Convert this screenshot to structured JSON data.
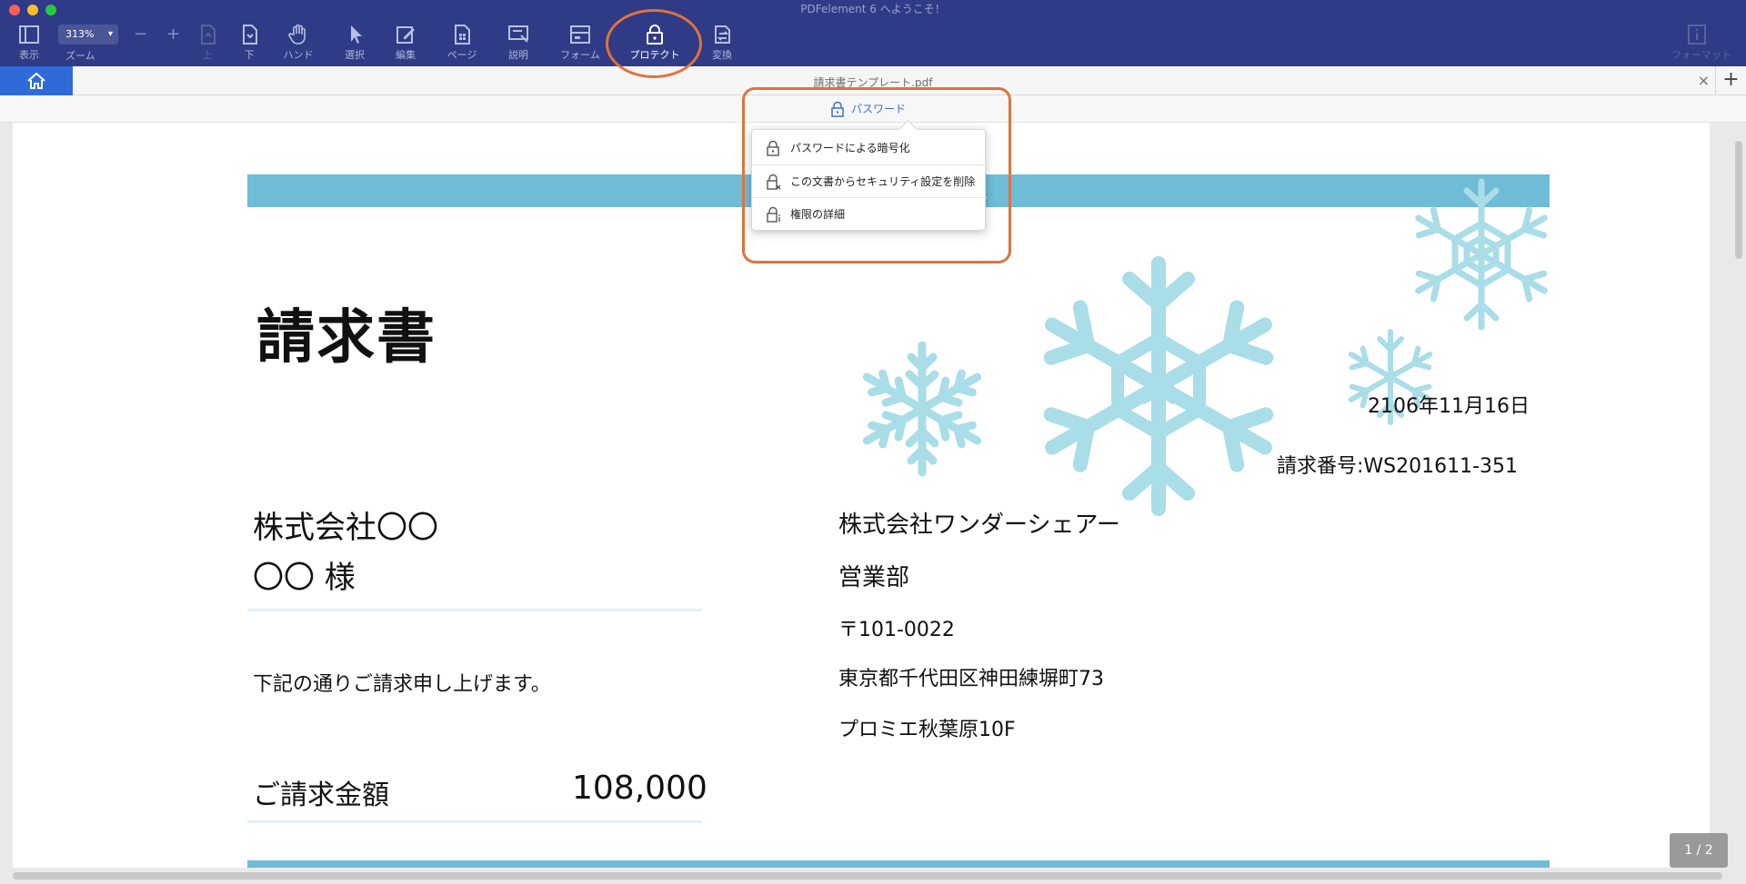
{
  "window": {
    "title": "PDFelement 6 へようこそ！"
  },
  "toolbar": {
    "view_label": "表示",
    "zoom_value": "313%",
    "zoom_label": "ズーム",
    "zoom_minus": "−",
    "zoom_plus": "+",
    "up_label": "上",
    "down_label": "下",
    "hand_label": "ハンド",
    "select_label": "選択",
    "edit_label": "編集",
    "page_label": "ページ",
    "comment_label": "説明",
    "form_label": "フォーム",
    "protect_label": "プロテクト",
    "convert_label": "変換",
    "format_label": "フォーマット"
  },
  "tabs": {
    "document_title": "請求書テンプレート.pdf",
    "close": "×",
    "add": "+"
  },
  "subbar": {
    "password_label": "パスワード"
  },
  "password_menu": {
    "items": [
      {
        "label": "パスワードによる暗号化",
        "icon": "lock-icon"
      },
      {
        "label": "この文書からセキュリティ設定を削除",
        "icon": "lock-remove-icon"
      },
      {
        "label": "権限の詳細",
        "icon": "lock-info-icon"
      }
    ]
  },
  "document": {
    "title": "請求書",
    "date": "2106年11月16日",
    "invoice_number": "請求番号:WS201611-351",
    "customer_company": "株式会社〇〇",
    "customer_person": "〇〇 様",
    "intro": "下記の通りご請求申し上げます。",
    "amount_label": "ご請求金額",
    "amount_value": "108,000",
    "sender_company": "株式会社ワンダーシェアー",
    "sender_dept": "営業部",
    "sender_zip": "〒101-0022",
    "sender_address": "東京都千代田区神田練塀町73",
    "sender_building": "プロミエ秋葉原10F"
  },
  "pager": {
    "indicator": "1 / 2"
  },
  "colors": {
    "toolbar_bg": "#2f3b86",
    "accent_blue": "#2f6bd8",
    "highlight_orange": "#e0733a",
    "band_blue": "#6fbcd6",
    "snowflake": "#a9dde8"
  }
}
